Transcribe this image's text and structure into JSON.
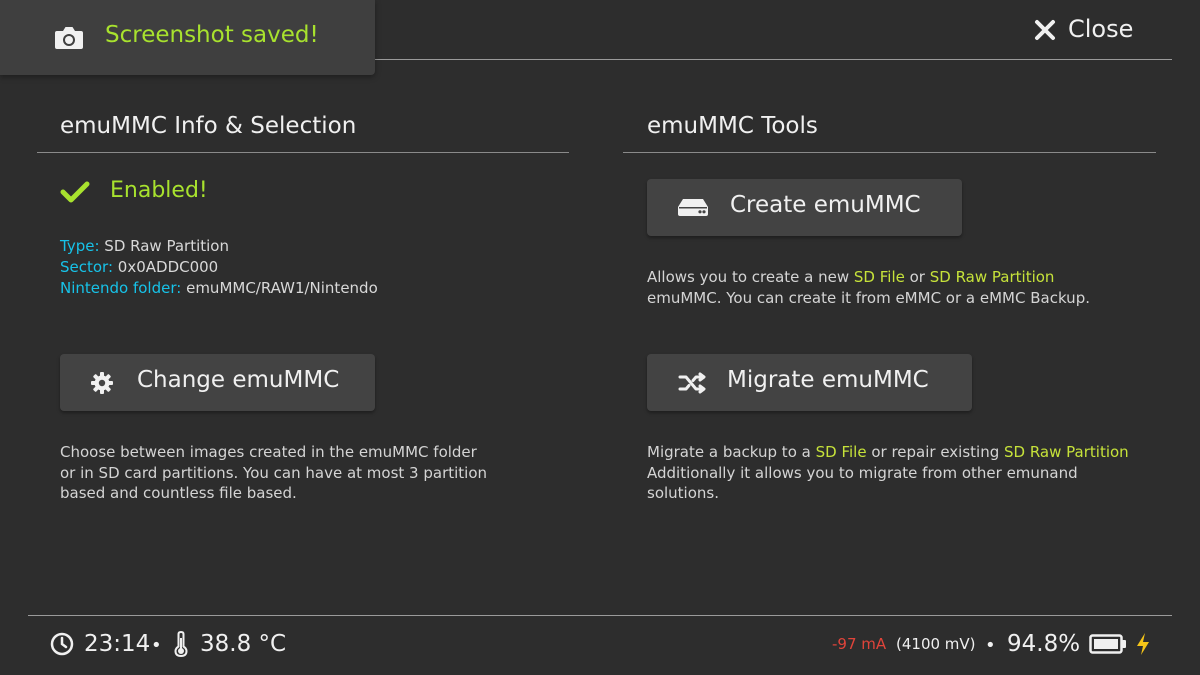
{
  "toast": {
    "icon": "camera-icon",
    "message": "Screenshot saved!"
  },
  "header": {
    "close_label": "Close",
    "close_icon": "close-icon"
  },
  "left": {
    "title": "emuMMC Info & Selection",
    "status": "Enabled!",
    "info": [
      {
        "key": "Type:",
        "value": "SD Raw Partition"
      },
      {
        "key": "Sector:",
        "value": "0x0ADDC000"
      },
      {
        "key": "Nintendo folder:",
        "value": "emuMMC/RAW1/Nintendo"
      }
    ],
    "button_label": "Change emuMMC",
    "description": [
      "Choose between images created in the emuMMC folder",
      "or in SD card partitions. You can have at most 3 partition",
      "based and countless file based."
    ]
  },
  "right": {
    "title": "emuMMC Tools",
    "create_label": "Create emuMMC",
    "create_desc": {
      "a": "Allows you to create a new ",
      "b": "SD File",
      "c": " or ",
      "d": "SD Raw Partition",
      "e": "emuMMC. You can create it from eMMC or a eMMC Backup."
    },
    "migrate_label": "Migrate emuMMC",
    "migrate_desc": {
      "a": "Migrate a backup to a ",
      "b": "SD File",
      "c": " or repair existing ",
      "d": "SD Raw Partition",
      "e": "Additionally it allows you to migrate from other emunand",
      "f": "solutions."
    }
  },
  "footer": {
    "time": "23:14",
    "separator": "•",
    "temperature": "38.8 °C",
    "current": "-97 mA",
    "voltage": "(4100 mV)",
    "battery": "94.8%"
  },
  "colors": {
    "background": "#2d2d2d",
    "accent_green": "#a8e22e",
    "info_key_cyan": "#17c2e8",
    "highlight_yellow": "#c6e23a",
    "current_red": "#e0443a",
    "charge_yellow": "#f5c518"
  }
}
